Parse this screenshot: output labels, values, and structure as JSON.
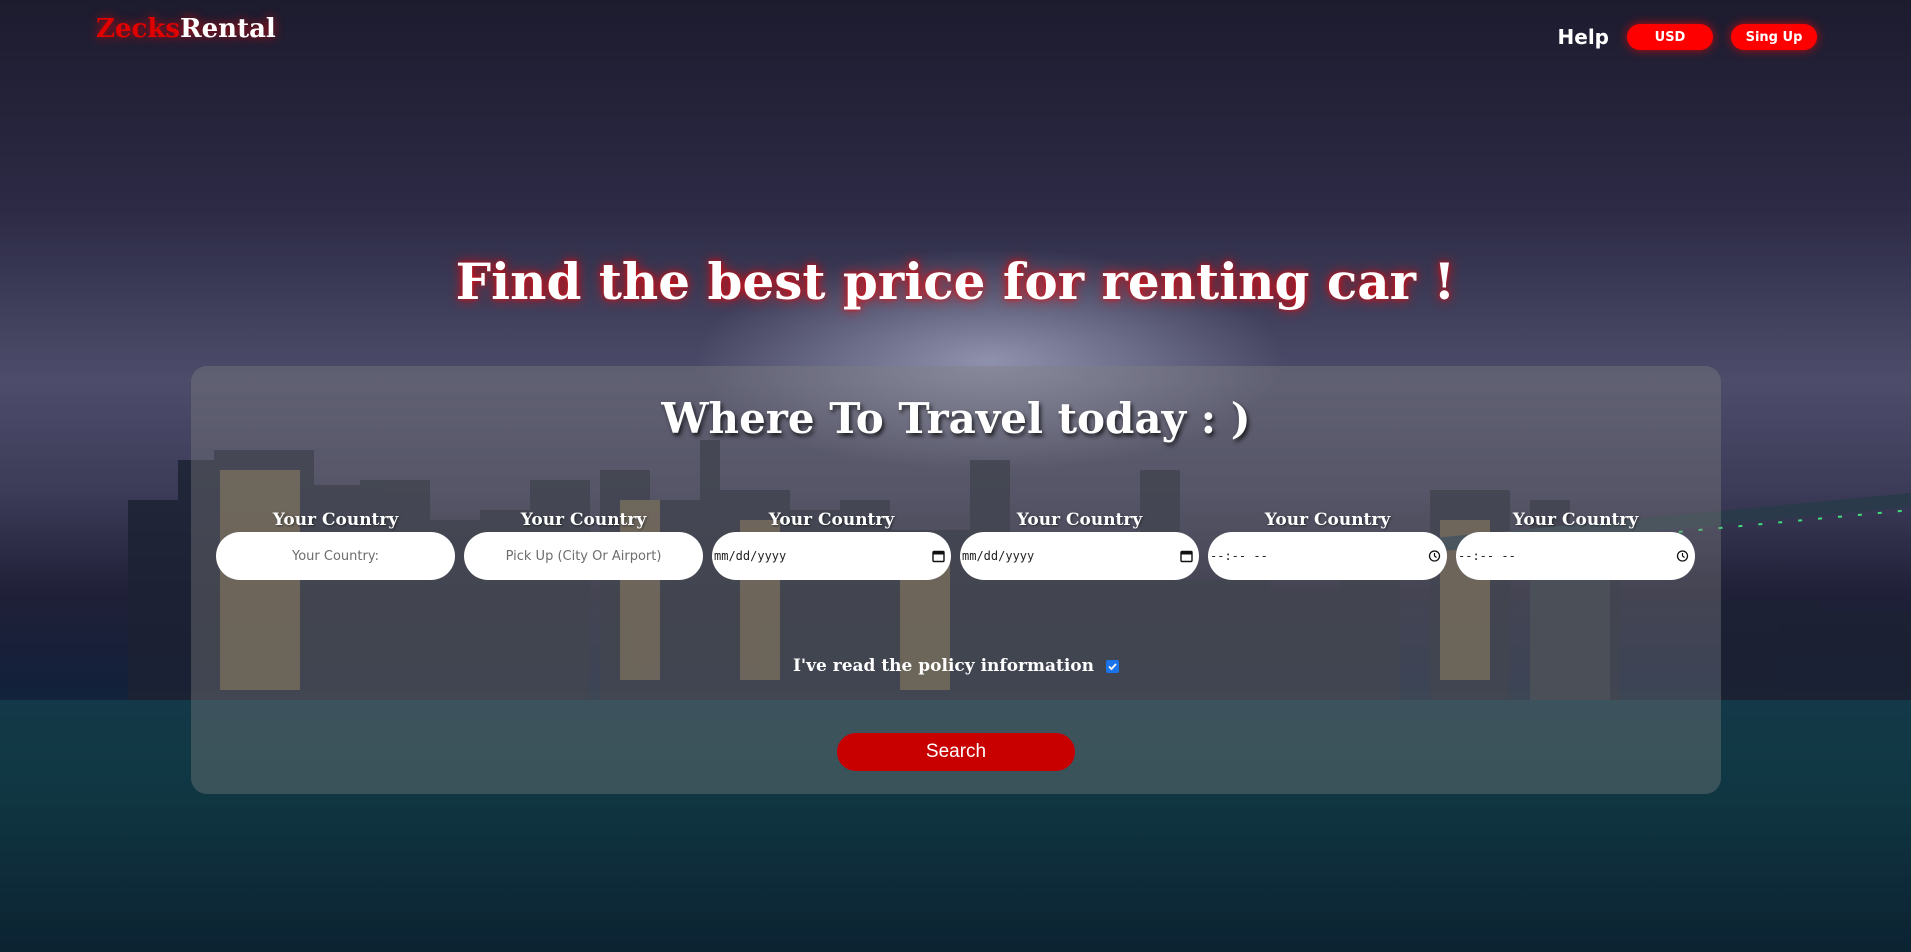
{
  "header": {
    "logo_part1": "Zecks",
    "logo_part2": "Rental",
    "help_label": "Help",
    "currency_label": "USD",
    "signup_label": "Sing Up"
  },
  "hero": {
    "title": "Find the best price for renting car !"
  },
  "search_panel": {
    "title": "Where To Travel today : )",
    "fields": [
      {
        "label": "Your Country",
        "placeholder": "Your Country:",
        "type": "text"
      },
      {
        "label": "Your Country",
        "placeholder": "Pick Up (City Or Airport)",
        "type": "text"
      },
      {
        "label": "Your Country",
        "value": "mm/dd/yyyy",
        "type": "date",
        "icon": "calendar-icon"
      },
      {
        "label": "Your Country",
        "value": "mm/dd/yyyy",
        "type": "date",
        "icon": "calendar-icon"
      },
      {
        "label": "Your Country",
        "value": "--:-- --",
        "type": "time",
        "icon": "clock-icon"
      },
      {
        "label": "Your Country",
        "value": "--:-- --",
        "type": "time",
        "icon": "clock-icon"
      }
    ],
    "policy_label": "I've read the policy information",
    "policy_checked": true,
    "search_label": "Search"
  },
  "colors": {
    "accent": "#ff0000",
    "search_button": "#c80000",
    "checkbox": "#1a73e8"
  }
}
